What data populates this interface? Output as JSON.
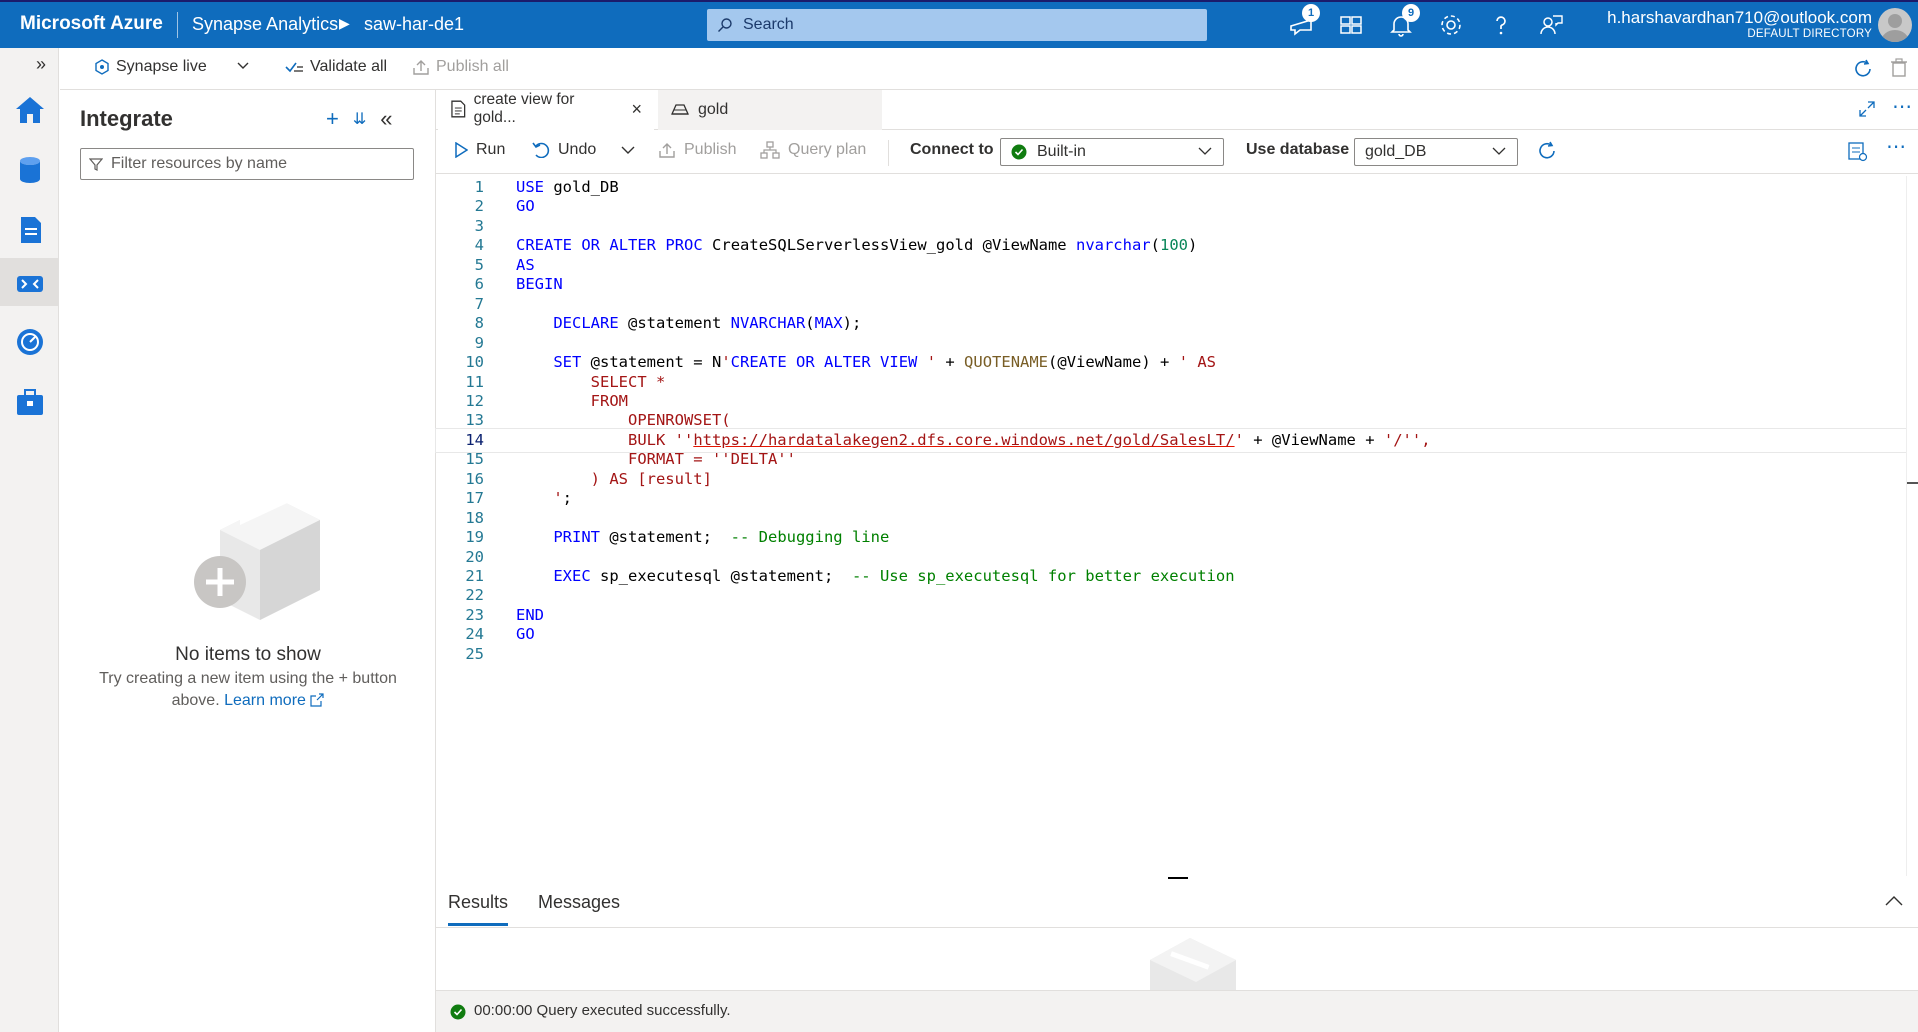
{
  "topbar": {
    "brand": "Microsoft Azure",
    "crumb_service": "Synapse Analytics",
    "crumb_workspace": "saw-har-de1",
    "search_placeholder": "Search",
    "feedback_badge": "1",
    "notification_badge": "9",
    "user_email": "h.harshavardhan710@outlook.com",
    "user_directory": "DEFAULT DIRECTORY"
  },
  "global_toolbar": {
    "synapse_live": "Synapse live",
    "validate_all": "Validate all",
    "publish_all": "Publish all"
  },
  "integrate_panel": {
    "title": "Integrate",
    "filter_placeholder": "Filter resources by name",
    "empty_title": "No items to show",
    "empty_desc": "Try creating a new item using the + button above.",
    "learn_more": "Learn more"
  },
  "tabs": [
    {
      "label": "create view for gold...",
      "active": true
    },
    {
      "label": "gold",
      "active": false
    }
  ],
  "editor_toolbar": {
    "run": "Run",
    "undo": "Undo",
    "publish": "Publish",
    "query_plan": "Query plan",
    "connect_to_label": "Connect to",
    "connect_to_value": "Built-in",
    "use_database_label": "Use database",
    "use_database_value": "gold_DB"
  },
  "code": {
    "current_line": 14,
    "lines": [
      "USE gold_DB",
      "GO",
      "",
      "CREATE OR ALTER PROC CreateSQLServerlessView_gold @ViewName nvarchar(100)",
      "AS",
      "BEGIN",
      "",
      "    DECLARE @statement NVARCHAR(MAX);",
      "",
      "    SET @statement = N'CREATE OR ALTER VIEW ' + QUOTENAME(@ViewName) + ' AS",
      "        SELECT *",
      "        FROM",
      "            OPENROWSET(",
      "            BULK ''https://hardatalakegen2.dfs.core.windows.net/gold/SalesLT/' + @ViewName + '/'',",
      "            FORMAT = ''DELTA''",
      "        ) AS [result]",
      "    ';",
      "",
      "    PRINT @statement;  -- Debugging line",
      "",
      "    EXEC sp_executesql @statement;  -- Use sp_executesql for better execution",
      "",
      "END",
      "GO",
      ""
    ]
  },
  "results": {
    "tab_results": "Results",
    "tab_messages": "Messages",
    "status": "00:00:00 Query executed successfully."
  },
  "colors": {
    "azure_blue": "#0f6cbd",
    "success_green": "#107c10",
    "keyword": "#0000ff",
    "string": "#a31515",
    "comment": "#008000"
  },
  "icons": [
    "home-icon",
    "data-icon",
    "develop-icon",
    "integrate-icon",
    "monitor-icon",
    "manage-icon"
  ]
}
